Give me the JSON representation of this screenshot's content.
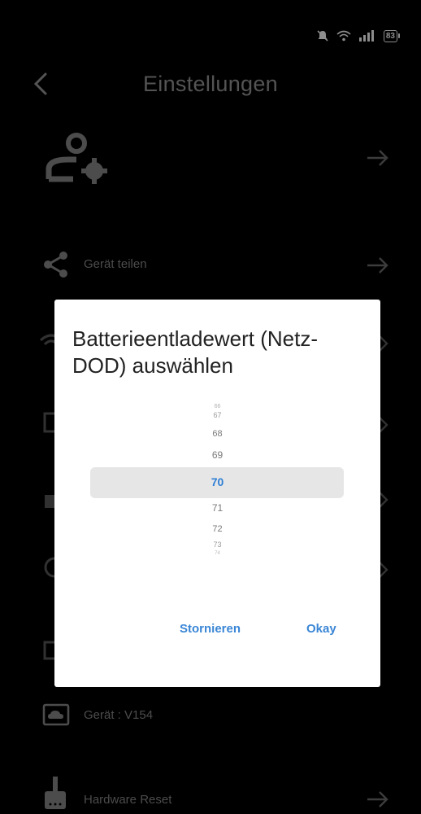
{
  "status": {
    "battery": "83"
  },
  "header": {
    "title": "Einstellungen"
  },
  "rows": {
    "share": "Gerät teilen",
    "device": "Gerät : V154",
    "reset": "Hardware Reset"
  },
  "dialog": {
    "title": "Batterieentladewert (Netz-DOD) auswählen",
    "picker": {
      "items": [
        "66",
        "67",
        "68",
        "69",
        "70",
        "71",
        "72",
        "73",
        "74"
      ],
      "selected": "70"
    },
    "cancel_label": "Stornieren",
    "ok_label": "Okay"
  },
  "colors": {
    "accent": "#3a86d6",
    "background": "#000000"
  }
}
